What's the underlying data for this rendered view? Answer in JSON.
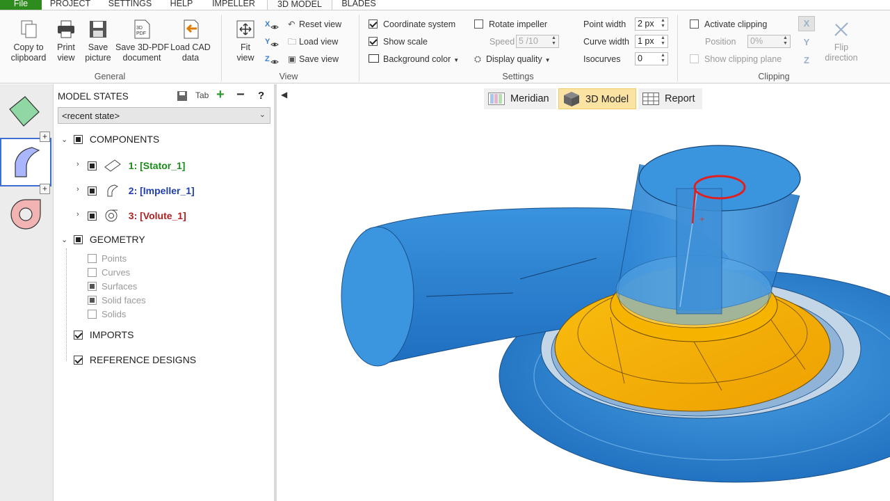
{
  "menu": {
    "tabs": [
      "File",
      "PROJECT",
      "SETTINGS",
      "HELP",
      "IMPELLER",
      "3D MODEL",
      "BLADES"
    ]
  },
  "ribbon": {
    "general": {
      "label": "General",
      "copy": "Copy to\nclipboard",
      "print": "Print\nview",
      "save_picture": "Save\npicture",
      "save_pdf": "Save 3D-PDF\ndocument",
      "load_cad": "Load CAD\ndata",
      "pdf_icon_text": "3D PDF"
    },
    "view": {
      "label": "View",
      "fit": "Fit\nview",
      "reset": "Reset view",
      "load": "Load view",
      "save": "Save view",
      "axes": [
        "X",
        "Y",
        "Z"
      ]
    },
    "settings": {
      "label": "Settings",
      "coordinate_system": "Coordinate system",
      "show_scale": "Show scale",
      "background_color": "Background color",
      "rotate_impeller": "Rotate impeller",
      "speed_label": "Speed",
      "speed_value": "5 /10",
      "display_quality": "Display quality",
      "point_width_label": "Point width",
      "point_width_value": "2 px",
      "curve_width_label": "Curve width",
      "curve_width_value": "1 px",
      "isocurves_label": "Isocurves",
      "isocurves_value": "0"
    },
    "clipping": {
      "label": "Clipping",
      "activate": "Activate clipping",
      "position_label": "Position",
      "position_value": "0%",
      "show_plane": "Show clipping plane",
      "flip": "Flip\ndirection",
      "axes": [
        "X",
        "Y",
        "Z"
      ]
    }
  },
  "panel": {
    "title": "MODEL STATES",
    "tab_icon": "Tab",
    "help": "?",
    "state_select": "<recent state>",
    "components_label": "COMPONENTS",
    "components": [
      {
        "label": "1: [Stator_1]",
        "color": "#1a8a1a"
      },
      {
        "label": "2: [Impeller_1]",
        "color": "#1f3fb0"
      },
      {
        "label": "3: [Volute_1]",
        "color": "#b01f1f"
      }
    ],
    "geometry_label": "GEOMETRY",
    "geometry_items": [
      "Points",
      "Curves",
      "Surfaces",
      "Solid faces",
      "Solids"
    ],
    "imports_label": "IMPORTS",
    "reference_label": "REFERENCE DESIGNS"
  },
  "viewport": {
    "tabs": [
      "Meridian",
      "3D Model",
      "Report"
    ],
    "active_tab": "3D Model"
  },
  "colors": {
    "file_tab": "#2e8b1e",
    "volute_blue": "#2f86d6",
    "impeller_orange": "#f5b000",
    "clip_red": "#e02020",
    "active_tab_bg": "#fbe3a4"
  }
}
